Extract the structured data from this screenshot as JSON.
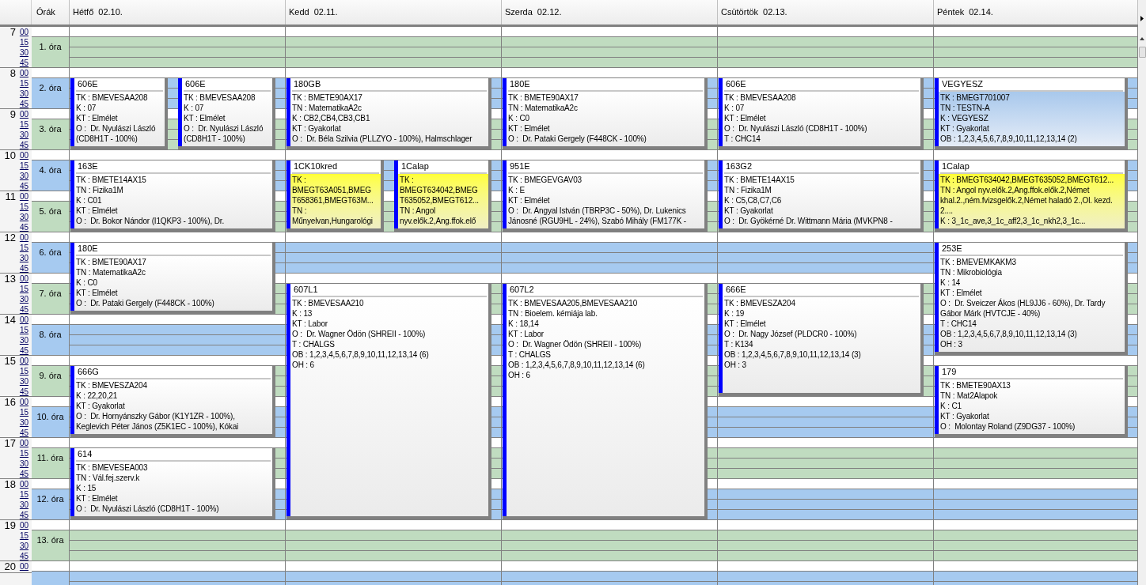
{
  "header": {
    "periods_label": "Órák"
  },
  "hours": [
    {
      "hour": "7",
      "minutes": [
        "00",
        "15",
        "30",
        "45"
      ]
    },
    {
      "hour": "8",
      "minutes": [
        "00",
        "15",
        "30",
        "45"
      ]
    },
    {
      "hour": "9",
      "minutes": [
        "00",
        "15",
        "30",
        "45"
      ]
    },
    {
      "hour": "10",
      "minutes": [
        "00",
        "15",
        "30",
        "45"
      ]
    },
    {
      "hour": "11",
      "minutes": [
        "00",
        "15",
        "30",
        "45"
      ]
    },
    {
      "hour": "12",
      "minutes": [
        "00",
        "15",
        "30",
        "45"
      ]
    },
    {
      "hour": "13",
      "minutes": [
        "00",
        "15",
        "30",
        "45"
      ]
    },
    {
      "hour": "14",
      "minutes": [
        "00",
        "15",
        "30",
        "45"
      ]
    },
    {
      "hour": "15",
      "minutes": [
        "00",
        "15",
        "30",
        "45"
      ]
    },
    {
      "hour": "16",
      "minutes": [
        "00",
        "15",
        "30",
        "45"
      ]
    },
    {
      "hour": "17",
      "minutes": [
        "00",
        "15",
        "30",
        "45"
      ]
    },
    {
      "hour": "18",
      "minutes": [
        "00",
        "15",
        "30",
        "45"
      ]
    },
    {
      "hour": "19",
      "minutes": [
        "00",
        "15",
        "30",
        "45"
      ]
    },
    {
      "hour": "20",
      "minutes": [
        "00"
      ]
    }
  ],
  "periods": [
    "1. óra",
    "2. óra",
    "3. óra",
    "4. óra",
    "5. óra",
    "6. óra",
    "7. óra",
    "8. óra",
    "9. óra",
    "10. óra",
    "11. óra",
    "12. óra",
    "13. óra"
  ],
  "days": [
    {
      "name": "Hétfő",
      "date": "02.10.",
      "slots": [
        {
          "kind": "free"
        },
        {
          "kind": "start",
          "events": [
            {
              "room": "606E",
              "kind": "normal",
              "lines": [
                "TK : BMEVESAA208",
                "K : 07",
                "KT : Elmélet",
                "O :  Dr. Nyulászi László",
                "(CD8H1T - 100%)"
              ]
            },
            {
              "room": "606E",
              "kind": "normal",
              "lines": [
                "TK : BMEVESAA208",
                "K : 07",
                "KT : Elmélet",
                "O :  Dr. Nyulászi László",
                "(CD8H1T - 100%)"
              ]
            }
          ]
        },
        {
          "kind": "continued"
        },
        {
          "kind": "start",
          "events": [
            {
              "room": "163E",
              "kind": "normal",
              "lines": [
                "TK : BMETE14AX15",
                "TN : Fizika1M",
                "K : C01",
                "KT : Elmélet",
                "O :  Dr. Bokor Nándor (I1QKP3 - 100%), Dr."
              ]
            }
          ]
        },
        {
          "kind": "continued"
        },
        {
          "kind": "start",
          "events": [
            {
              "room": "180E",
              "kind": "normal",
              "lines": [
                "TK : BMETE90AX17",
                "TN : MatematikaA2c",
                "K : C0",
                "KT : Elmélet",
                "O :  Dr. Pataki Gergely (F448CK - 100%)"
              ]
            }
          ]
        },
        {
          "kind": "continued"
        },
        {
          "kind": "free"
        },
        {
          "kind": "start",
          "events": [
            {
              "room": "666G",
              "kind": "normal",
              "lines": [
                "TK : BMEVESZA204",
                "K : 22,20,21",
                "KT : Gyakorlat",
                "O :  Dr. Hornyánszky Gábor (K1Y1ZR - 100%),",
                "Keglevich Péter János (Z5K1EC - 100%), Kókai"
              ]
            }
          ]
        },
        {
          "kind": "continued"
        },
        {
          "kind": "start",
          "events": [
            {
              "room": "614",
              "kind": "normal",
              "lines": [
                "TK : BMEVESEA003",
                "TN : Vál.fej.szerv.k",
                "K : 15",
                "KT : Elmélet",
                "O :  Dr. Nyulászi László (CD8H1T - 100%)"
              ]
            }
          ]
        },
        {
          "kind": "continued"
        },
        {
          "kind": "free"
        }
      ]
    },
    {
      "name": "Kedd",
      "date": "02.11.",
      "slots": [
        {
          "kind": "free"
        },
        {
          "kind": "start",
          "events": [
            {
              "room": "180GB",
              "kind": "normal",
              "lines": [
                "TK : BMETE90AX17",
                "TN : MatematikaA2c",
                "K : CB2,CB4,CB3,CB1",
                "KT : Gyakorlat",
                "O :  Dr. Béla Szilvia (PLLZYO - 100%), Halmschlager"
              ]
            }
          ]
        },
        {
          "kind": "continued"
        },
        {
          "kind": "start",
          "events": [
            {
              "room": "1CK10kred",
              "kind": "highlight",
              "lines": [
                "TK :",
                "BMEGT63A051,BMEG",
                "T658361,BMEGT63M...",
                "TN :",
                "Műnyelvan,Hungarológi"
              ]
            },
            {
              "room": "1Calap",
              "kind": "highlight",
              "lines": [
                "TK :",
                "BMEGT634042,BMEG",
                "T635052,BMEGT612...",
                "TN : Angol",
                "nyv.elők.2,Ang.ffok.elő"
              ]
            }
          ]
        },
        {
          "kind": "continued"
        },
        {
          "kind": "free"
        },
        {
          "kind": "start",
          "events": [
            {
              "room": "607L1",
              "kind": "normal",
              "lines": [
                "TK : BMEVESAA210",
                "K : 13",
                "KT : Labor",
                "O :  Dr. Wagner Ödön (SHREII - 100%)",
                "T : CHALGS",
                "OB : 1,2,3,4,5,6,7,8,9,10,11,12,13,14 (6)",
                "OH : 6"
              ]
            }
          ]
        },
        {
          "kind": "continued"
        },
        {
          "kind": "continued"
        },
        {
          "kind": "continued"
        },
        {
          "kind": "continued"
        },
        {
          "kind": "continued"
        },
        {
          "kind": "free"
        }
      ]
    },
    {
      "name": "Szerda",
      "date": "02.12.",
      "slots": [
        {
          "kind": "free"
        },
        {
          "kind": "start",
          "events": [
            {
              "room": "180E",
              "kind": "normal",
              "lines": [
                "TK : BMETE90AX17",
                "TN : MatematikaA2c",
                "K : C0",
                "KT : Elmélet",
                "O :  Dr. Pataki Gergely (F448CK - 100%)"
              ]
            }
          ]
        },
        {
          "kind": "continued"
        },
        {
          "kind": "start",
          "events": [
            {
              "room": "951E",
              "kind": "normal",
              "lines": [
                "TK : BMEGEVGAV03",
                "K : E",
                "KT : Elmélet",
                "O :  Dr. Angyal István (TBRP3C - 50%), Dr. Lukenics",
                "Jánosné (RGU9HL - 24%), Szabó Mihály (FM177K -"
              ]
            }
          ]
        },
        {
          "kind": "continued"
        },
        {
          "kind": "free"
        },
        {
          "kind": "start",
          "events": [
            {
              "room": "607L2",
              "kind": "normal",
              "lines": [
                "TK : BMEVESAA205,BMEVESAA210",
                "TN : Bioelem. kémiája lab.",
                "K : 18,14",
                "KT : Labor",
                "O :  Dr. Wagner Ödön (SHREII - 100%)",
                "T : CHALGS",
                "OB : 1,2,3,4,5,6,7,8,9,10,11,12,13,14 (6)",
                "OH : 6"
              ]
            }
          ]
        },
        {
          "kind": "continued"
        },
        {
          "kind": "continued"
        },
        {
          "kind": "continued"
        },
        {
          "kind": "continued"
        },
        {
          "kind": "continued"
        },
        {
          "kind": "free"
        }
      ]
    },
    {
      "name": "Csütörtök",
      "date": "02.13.",
      "slots": [
        {
          "kind": "free"
        },
        {
          "kind": "start",
          "events": [
            {
              "room": "606E",
              "kind": "normal",
              "lines": [
                "TK : BMEVESAA208",
                "K : 07",
                "KT : Elmélet",
                "O :  Dr. Nyulászi László (CD8H1T - 100%)",
                "T : CHC14"
              ]
            }
          ]
        },
        {
          "kind": "continued"
        },
        {
          "kind": "start",
          "events": [
            {
              "room": "163G2",
              "kind": "normal",
              "lines": [
                "TK : BMETE14AX15",
                "TN : Fizika1M",
                "K : C5,C8,C7,C6",
                "KT : Gyakorlat",
                "O :  Dr. Gyökérné Dr. Wittmann Mária (MVKPN8 -"
              ]
            }
          ]
        },
        {
          "kind": "continued"
        },
        {
          "kind": "free"
        },
        {
          "kind": "start",
          "events": [
            {
              "room": "666E",
              "kind": "normal",
              "lines": [
                "TK : BMEVESZA204",
                "K : 19",
                "KT : Elmélet",
                "O :  Dr. Nagy József (PLDCR0 - 100%)",
                "T : K134",
                "OB : 1,2,3,4,5,6,7,8,9,10,11,12,13,14 (3)",
                "OH : 3"
              ]
            }
          ]
        },
        {
          "kind": "continued"
        },
        {
          "kind": "continued"
        },
        {
          "kind": "free"
        },
        {
          "kind": "free"
        },
        {
          "kind": "free"
        },
        {
          "kind": "free"
        }
      ]
    },
    {
      "name": "Péntek",
      "date": "02.14.",
      "slots": [
        {
          "kind": "free"
        },
        {
          "kind": "start",
          "events": [
            {
              "room": "VEGYESZ",
              "kind": "selected",
              "lines": [
                "TK : BMEGT701007",
                "TN : TESTN-A",
                "K : VEGYESZ",
                "KT : Gyakorlat",
                "OB : 1,2,3,4,5,6,7,8,9,10,11,12,13,14 (2)"
              ]
            }
          ]
        },
        {
          "kind": "continued"
        },
        {
          "kind": "start",
          "events": [
            {
              "room": "1Calap",
              "kind": "highlight",
              "lines": [
                "TK : BMEGT634042,BMEGT635052,BMEGT612...",
                "TN : Angol nyv.elők.2,Ang.ffok.elők.2,Német",
                "khal.2.,ném.fvizsgelők.2,Német haladó 2.,Ol. kezd.",
                "2....",
                "K : 3_1c_ave,3_1c_aff2,3_1c_nkh2,3_1c..."
              ]
            }
          ]
        },
        {
          "kind": "continued"
        },
        {
          "kind": "start",
          "events": [
            {
              "room": "253E",
              "kind": "normal",
              "lines": [
                "TK : BMEVEMKAKM3",
                "TN : Mikrobiológia",
                "K : 14",
                "KT : Elmélet",
                "O :  Dr. Sveiczer Ákos (HL9JJ6 - 60%), Dr. Tardy",
                "Gábor Márk (HVTCJE - 40%)",
                "T : CHC14",
                "OB : 1,2,3,4,5,6,7,8,9,10,11,12,13,14 (3)",
                "OH : 3"
              ]
            }
          ]
        },
        {
          "kind": "continued"
        },
        {
          "kind": "continued"
        },
        {
          "kind": "start",
          "events": [
            {
              "room": "179",
              "kind": "normal",
              "lines": [
                "TK : BMETE90AX13",
                "TN : Mat2Alapok",
                "K : C1",
                "KT : Gyakorlat",
                "O :  Molontay Roland (Z9DG37 - 100%)"
              ]
            }
          ]
        },
        {
          "kind": "continued"
        },
        {
          "kind": "free"
        },
        {
          "kind": "free"
        },
        {
          "kind": "free"
        }
      ]
    }
  ]
}
